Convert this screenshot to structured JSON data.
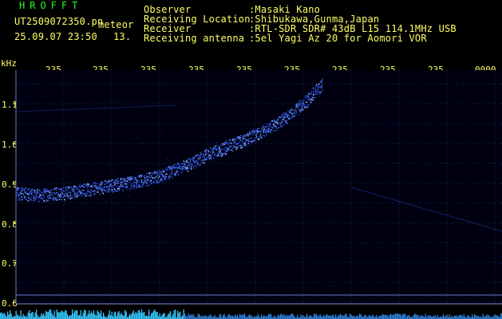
{
  "header": {
    "app_name": "HROFFT",
    "file_name": "UT2509072350.pn",
    "event_type": "meteor",
    "timestamp": "25.09.07 23:50",
    "counter": "13.",
    "info": [
      {
        "label": "Observer",
        "value": ":Masaki Kano"
      },
      {
        "label": "Receiving Location",
        "value": ":Shibukawa,Gunma,Japan"
      },
      {
        "label": "Receiver",
        "value": ":RTL-SDR SDR# 43dB L15 114.1MHz USB"
      },
      {
        "label": "Receiving antenna",
        "value": ":5el Yagi Az 20 for Aomori VOR"
      }
    ]
  },
  "spectrogram": {
    "unit_label": "kHz",
    "y_ticks": [
      "1.1",
      "1.0",
      "0.9",
      "0.8",
      "0.7",
      "0.6"
    ],
    "x_ticks": [
      "235",
      "235",
      "235",
      "235",
      "235",
      "235",
      "235",
      "235",
      "235",
      "0000"
    ],
    "y_range": [
      0.6,
      1.15
    ],
    "background_color": "#000010",
    "grid_color": "#1a2a6a",
    "signal_color": "#3a6cff",
    "text_color": "#ffff66",
    "title_color": "#22ff22",
    "trace_khz": [
      [
        0.0,
        0.875
      ],
      [
        0.05,
        0.87
      ],
      [
        0.1,
        0.875
      ],
      [
        0.15,
        0.885
      ],
      [
        0.2,
        0.895
      ],
      [
        0.25,
        0.905
      ],
      [
        0.3,
        0.92
      ],
      [
        0.35,
        0.945
      ],
      [
        0.4,
        0.975
      ],
      [
        0.45,
        1.0
      ],
      [
        0.5,
        1.025
      ],
      [
        0.55,
        1.06
      ],
      [
        0.6,
        1.11
      ],
      [
        0.63,
        1.15
      ]
    ]
  }
}
